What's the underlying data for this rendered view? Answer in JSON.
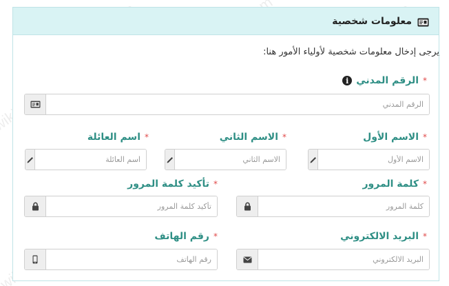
{
  "panel": {
    "title": "معلومات شخصية"
  },
  "intro": "يرجى إدخال معلومات شخصية لأولياء الأمور هنا:",
  "required_mark": "*",
  "fields": {
    "civil_id": {
      "label": "الرقم المدني",
      "placeholder": "الرقم المدني",
      "icon": "id-card-icon"
    },
    "first_name": {
      "label": "الاسم الأول",
      "placeholder": "الاسم الأول",
      "icon": "pencil-icon"
    },
    "second_name": {
      "label": "الاسم الثاني",
      "placeholder": "الاسم الثاني",
      "icon": "pencil-icon"
    },
    "family_name": {
      "label": "اسم العائلة",
      "placeholder": "اسم العائلة",
      "icon": "pencil-icon"
    },
    "password": {
      "label": "كلمة المرور",
      "placeholder": "كلمة المرور",
      "icon": "lock-icon"
    },
    "confirm_password": {
      "label": "تأكيد كلمة المرور",
      "placeholder": "تأكيد كلمة المرور",
      "icon": "lock-icon"
    },
    "email": {
      "label": "البريد الالكتروني",
      "placeholder": "البريد الالكتروني",
      "icon": "envelope-icon"
    },
    "phone": {
      "label": "رقم الهاتف",
      "placeholder": "رقم الهاتف",
      "icon": "mobile-icon"
    }
  },
  "watermark": "wikikuwait.com"
}
